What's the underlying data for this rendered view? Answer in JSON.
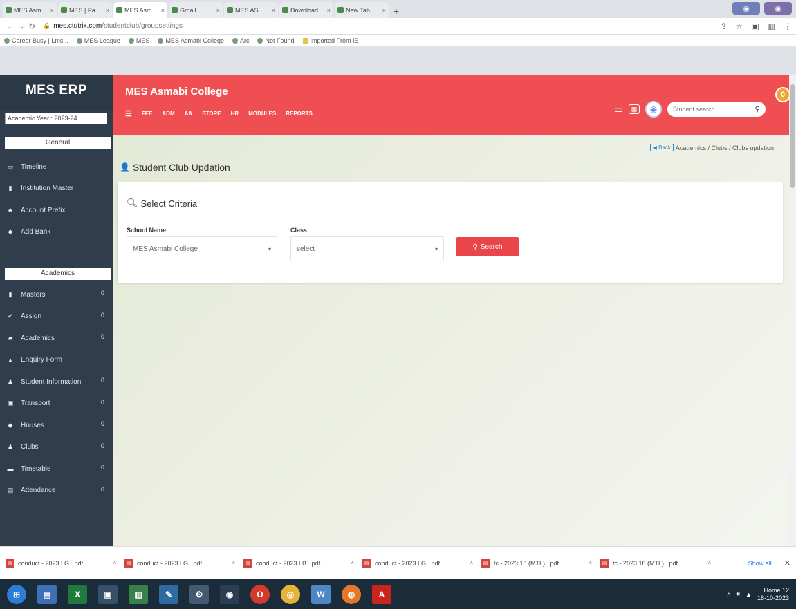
{
  "browser": {
    "tabs": [
      {
        "title": "MES Asmabi College",
        "active": false
      },
      {
        "title": "MES | Pan index",
        "active": false
      },
      {
        "title": "MES Asmabi College",
        "active": true
      },
      {
        "title": "Gmail",
        "active": false
      },
      {
        "title": "MES ASMABI admin",
        "active": false
      },
      {
        "title": "Download file | iLovePDF",
        "active": false
      },
      {
        "title": "New Tab",
        "active": false
      }
    ],
    "url_host": "mes.ctutrix.com",
    "url_path": "/studentclub/groupsettings",
    "bookmarks": [
      {
        "label": "Career Busy | Lms...",
        "type": "site"
      },
      {
        "label": "MES League",
        "type": "site"
      },
      {
        "label": "MES",
        "type": "site"
      },
      {
        "label": "MES Asmabi College",
        "type": "site"
      },
      {
        "label": "Arc",
        "type": "site"
      },
      {
        "label": "Not Found",
        "type": "site"
      },
      {
        "label": "Imported From IE",
        "type": "folder"
      }
    ]
  },
  "app": {
    "brand": "MES ERP",
    "academic_year": "Academic Year : 2023-24",
    "college_name": "MES Asmabi College",
    "top_menu": [
      "FEE",
      "ADM",
      "AA",
      "STORE",
      "HR",
      "MODULES",
      "REPORTS"
    ],
    "search_placeholder": "Student search",
    "notification_count": "0",
    "sidebar": {
      "general_header": "General",
      "general_items": [
        {
          "label": "Timeline",
          "icon": "monitor-icon"
        },
        {
          "label": "Institution Master",
          "icon": "building-icon"
        },
        {
          "label": "Account Prefix",
          "icon": "users-icon"
        },
        {
          "label": "Add Bank",
          "icon": "bank-icon"
        }
      ],
      "academics_header": "Academics",
      "academic_items": [
        {
          "label": "Masters",
          "icon": "book-icon",
          "count": "0"
        },
        {
          "label": "Assign",
          "icon": "check-icon",
          "count": "0"
        },
        {
          "label": "Academics",
          "icon": "graduation-icon",
          "count": "0"
        },
        {
          "label": "Enquiry Form",
          "icon": "form-icon",
          "count": ""
        },
        {
          "label": "Student Information",
          "icon": "student-icon",
          "count": "0"
        },
        {
          "label": "Transport",
          "icon": "bus-icon",
          "count": "0"
        },
        {
          "label": "Houses",
          "icon": "house-icon",
          "count": "0"
        },
        {
          "label": "Clubs",
          "icon": "club-icon",
          "count": "0"
        },
        {
          "label": "Timetable",
          "icon": "table-icon",
          "count": "0"
        },
        {
          "label": "Attendance",
          "icon": "calendar-icon",
          "count": "0"
        }
      ]
    },
    "breadcrumb": {
      "back": "Back",
      "trail": "Academics / Clubs / Clubs updation"
    },
    "page_title": "Student Club Updation",
    "criteria_title": "Select Criteria",
    "school_label": "School Name",
    "school_value": "MES Asmabi College",
    "class_label": "Class",
    "class_value": "select",
    "search_button": "Search"
  },
  "downloads": {
    "files": [
      "conduct - 2023 LG...pdf",
      "conduct - 2023 LG...pdf",
      "conduct - 2023 LB...pdf",
      "conduct - 2023 LG...pdf",
      "tc - 2023 18 (MTL)...pdf",
      "tc - 2023 18 (MTL)...pdf"
    ],
    "show_all": "Show all"
  },
  "taskbar": {
    "time": "Home 12",
    "date": "18-10-2023"
  },
  "colors": {
    "header_red": "#ef4e52",
    "sidebar_dark": "#2f3d4d",
    "search_button": "#e9454a",
    "notification": "#f0a533"
  }
}
